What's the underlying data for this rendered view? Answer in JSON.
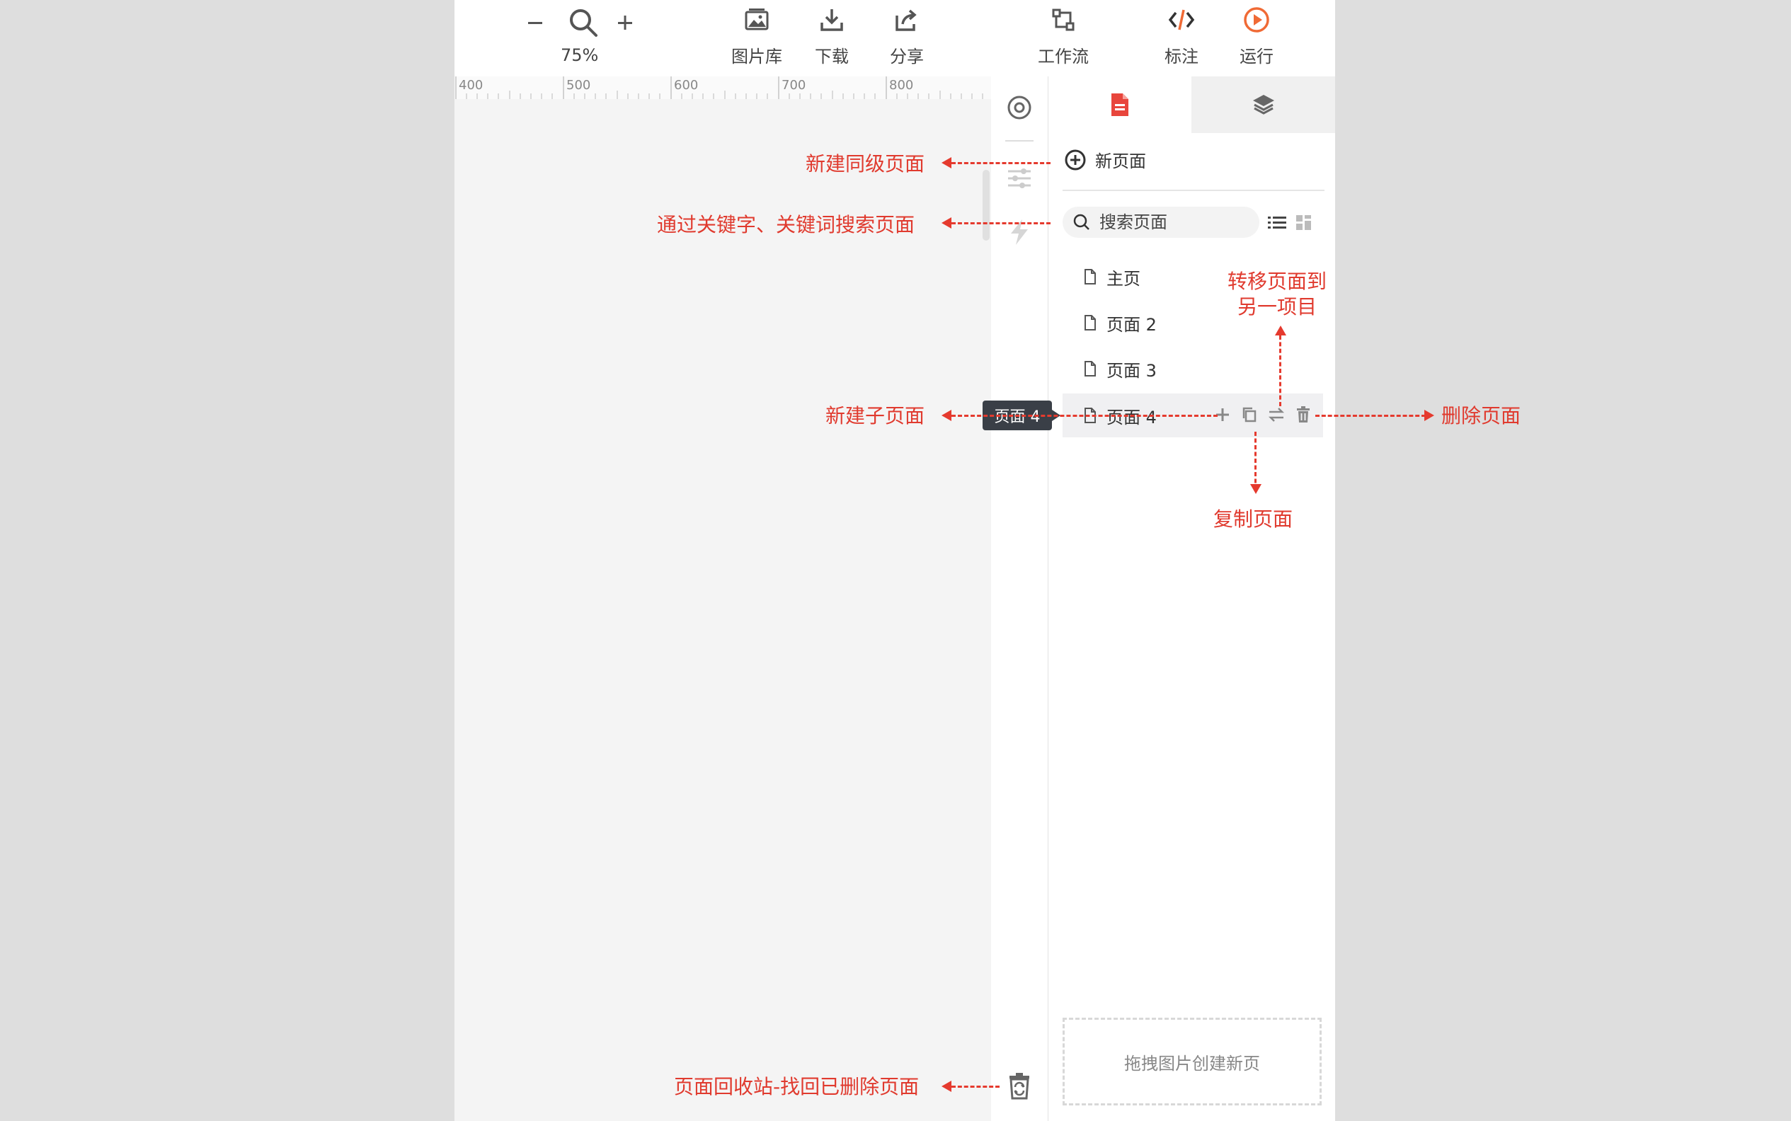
{
  "toolbar": {
    "zoom_level": "75%",
    "image_library": "图片库",
    "download": "下载",
    "share": "分享",
    "workflow": "工作流",
    "annotate": "标注",
    "run": "运行"
  },
  "ruler": {
    "ticks": [
      "400",
      "500",
      "600",
      "700",
      "800"
    ]
  },
  "panel": {
    "new_page": "新页面",
    "search_placeholder": "搜索页面",
    "pages": [
      "主页",
      "页面 2",
      "页面 3",
      "页面 4"
    ],
    "active_page": "页面 4",
    "drop_hint": "拖拽图片创建新页"
  },
  "tooltip": "页面 4",
  "annotations": {
    "new_sibling": "新建同级页面",
    "search": "通过关键字、关键词搜索页面",
    "move_line1": "转移页面到",
    "move_line2": "另一项目",
    "new_child": "新建子页面",
    "delete": "删除页面",
    "copy": "复制页面",
    "recycle": "页面回收站-找回已删除页面"
  },
  "colors": {
    "accent": "#e8453c",
    "annotation": "#e03a2e",
    "run": "#f06a35"
  }
}
